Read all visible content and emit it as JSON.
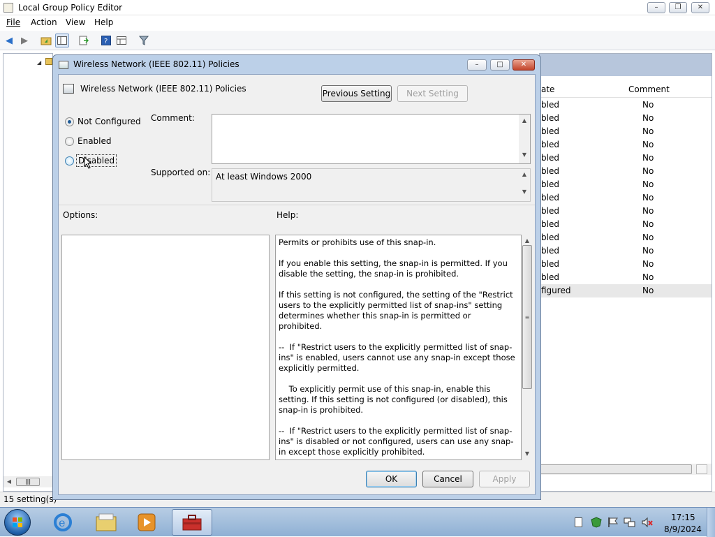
{
  "window": {
    "title": "Local Group Policy Editor",
    "controls": [
      "minimize",
      "restore",
      "close"
    ]
  },
  "menu": [
    "File",
    "Action",
    "View",
    "Help"
  ],
  "toolbar_icons": [
    "back-icon",
    "forward-icon",
    "up-folder-icon",
    "show-hide-tree-icon",
    "export-list-icon",
    "help-icon",
    "properties-icon",
    "filter-icon"
  ],
  "right_pane": {
    "column_headers": {
      "state": "ate",
      "comment": "Comment"
    },
    "rows": [
      {
        "state": "bled",
        "comment": "No"
      },
      {
        "state": "bled",
        "comment": "No"
      },
      {
        "state": "bled",
        "comment": "No"
      },
      {
        "state": "bled",
        "comment": "No"
      },
      {
        "state": "bled",
        "comment": "No"
      },
      {
        "state": "bled",
        "comment": "No"
      },
      {
        "state": "bled",
        "comment": "No"
      },
      {
        "state": "bled",
        "comment": "No"
      },
      {
        "state": "bled",
        "comment": "No"
      },
      {
        "state": "bled",
        "comment": "No"
      },
      {
        "state": "bled",
        "comment": "No"
      },
      {
        "state": "bled",
        "comment": "No"
      },
      {
        "state": "bled",
        "comment": "No"
      },
      {
        "state": "bled",
        "comment": "No"
      },
      {
        "state": "figured",
        "comment": "No"
      }
    ]
  },
  "status": {
    "text": "15 setting(s)"
  },
  "dialog": {
    "title": "Wireless Network (IEEE 802.11) Policies",
    "header": "Wireless Network (IEEE 802.11) Policies",
    "previous_setting": "Previous Setting",
    "next_setting": "Next Setting",
    "radio_not_configured": "Not Configured",
    "radio_enabled": "Enabled",
    "radio_disabled": "Disabled",
    "selected": "Not Configured",
    "comment_label": "Comment:",
    "comment_value": "",
    "supported_label": "Supported on:",
    "supported_value": "At least Windows 2000",
    "options_label": "Options:",
    "help_label": "Help:",
    "help_paragraphs": [
      "Permits or prohibits use of this snap-in.",
      "If you enable this setting, the snap-in is permitted. If you disable the setting, the snap-in is prohibited.",
      "If this setting is not configured, the setting of the \"Restrict users to the explicitly permitted list of snap-ins\" setting determines whether this snap-in is permitted or prohibited.",
      "--  If \"Restrict users to the explicitly permitted list of snap-ins\" is enabled, users cannot use any snap-in except those explicitly permitted.",
      "    To explicitly permit use of this snap-in, enable this setting. If this setting is not configured (or disabled), this snap-in is prohibited.",
      "--  If \"Restrict users to the explicitly permitted list of snap-ins\" is disabled or not configured, users can use any snap-in except those explicitly prohibited."
    ],
    "ok": "OK",
    "cancel": "Cancel",
    "apply": "Apply"
  },
  "taskbar": {
    "apps": [
      "start-orb-icon",
      "internet-explorer-icon",
      "explorer-icon",
      "media-player-icon",
      "group-policy-toolbox-icon"
    ],
    "tray_icons": [
      "document-icon",
      "security-shield-icon",
      "flag-icon",
      "network-icon",
      "volume-muted-icon"
    ],
    "time": "17:15",
    "date": "8/9/2024"
  }
}
